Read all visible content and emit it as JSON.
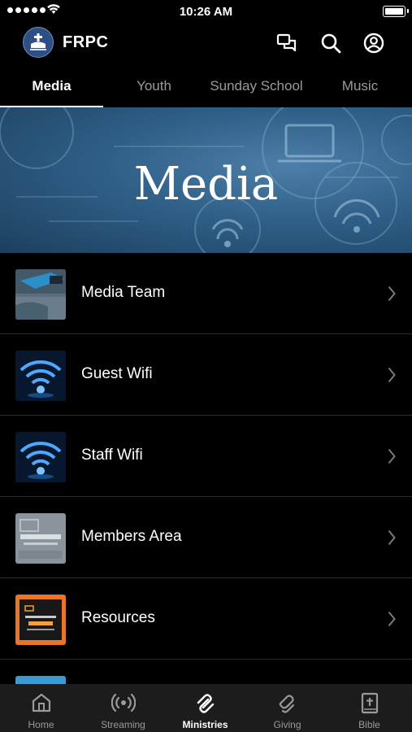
{
  "status_bar": {
    "time": "10:26 AM"
  },
  "header": {
    "title": "FRPC",
    "icons": [
      "chat-icon",
      "search-icon",
      "account-icon"
    ]
  },
  "tabs": [
    {
      "label": "Media",
      "active": true
    },
    {
      "label": "Youth",
      "active": false
    },
    {
      "label": "Sunday School",
      "active": false
    },
    {
      "label": "Music",
      "active": false
    }
  ],
  "hero": {
    "title": "Media"
  },
  "items": [
    {
      "label": "Media Team"
    },
    {
      "label": "Guest Wifi"
    },
    {
      "label": "Staff Wifi"
    },
    {
      "label": "Members Area"
    },
    {
      "label": "Resources"
    }
  ],
  "bottom_nav": [
    {
      "label": "Home",
      "icon": "home-icon",
      "active": false
    },
    {
      "label": "Streaming",
      "icon": "streaming-icon",
      "active": false
    },
    {
      "label": "Ministries",
      "icon": "ministries-icon",
      "active": true
    },
    {
      "label": "Giving",
      "icon": "giving-icon",
      "active": false
    },
    {
      "label": "Bible",
      "icon": "bible-icon",
      "active": false
    }
  ],
  "colors": {
    "background": "#000000",
    "hero": "#2f5f87",
    "nav_bar": "#1c1c1c",
    "inactive_text": "#9a9a9a"
  }
}
